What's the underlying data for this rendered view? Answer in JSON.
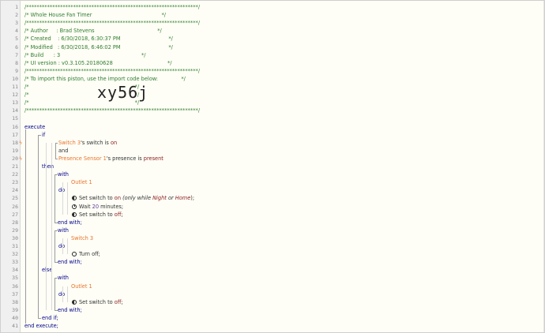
{
  "header_comments": [
    "/******************************************************************/",
    "/* Whole House Fan Timer                                          */",
    "/******************************************************************/",
    "/* Author     : Brad Stevens                                      */",
    "/* Created    : 6/30/2018, 6:30:37 PM                             */",
    "/* Modified   : 6/30/2018, 6:46:02 PM                             */",
    "/* Build      : 3                                                 */",
    "/* UI version : v0.3.105.20180628                                 */",
    "/******************************************************************/",
    "/* To import this piston, use the import code below:              */",
    "/*                                                                */",
    "/*                                                                */",
    "/*                                                                */",
    "/******************************************************************/"
  ],
  "import_code": "xy56j",
  "line_numbers": [
    "1",
    "2",
    "3",
    "4",
    "5",
    "6",
    "7",
    "8",
    "9",
    "10",
    "11",
    "12",
    "13",
    "14",
    "15",
    "16",
    "17",
    "18",
    "19",
    "20",
    "21",
    "22",
    "23",
    "24",
    "25",
    "26",
    "27",
    "28",
    "29",
    "30",
    "31",
    "32",
    "33",
    "34",
    "35",
    "36",
    "37",
    "38",
    "39",
    "40",
    "41"
  ],
  "markers": {
    "l18": "ϟ",
    "l20": "ϟ"
  },
  "code": {
    "execute": "execute",
    "if": "if",
    "cond1_dev": "Switch 3",
    "cond1_rest": "'s switch is ",
    "cond1_val": "on",
    "and": "and",
    "cond2_dev": "Presence Sensor 1",
    "cond2_rest": "'s presence is ",
    "cond2_val": "present",
    "then": "then",
    "with1": "with",
    "with1_dev": "Outlet 1",
    "do1": "do",
    "a1_pre": "Set switch to ",
    "a1_val": "on",
    "a1_paren1": " (only while ",
    "a1_night": "Night",
    "a1_or": " or ",
    "a1_home": "Home",
    "a1_paren2": ");",
    "a2_pre": "Wait ",
    "a2_val": "20",
    "a2_post": " minutes;",
    "a3_pre": "Set switch to ",
    "a3_val": "off",
    "a3_post": ";",
    "endwith1": "end with;",
    "with2": "with",
    "with2_dev": "Switch 3",
    "do2": "do",
    "a4": "Turn off;",
    "endwith2": "end with;",
    "else": "else",
    "with3": "with",
    "with3_dev": "Outlet 1",
    "do3": "do",
    "a5_pre": "Set switch to ",
    "a5_val": "off",
    "a5_post": ";",
    "endwith3": "end with;",
    "endif": "end if;",
    "endexecute": "end execute;"
  }
}
